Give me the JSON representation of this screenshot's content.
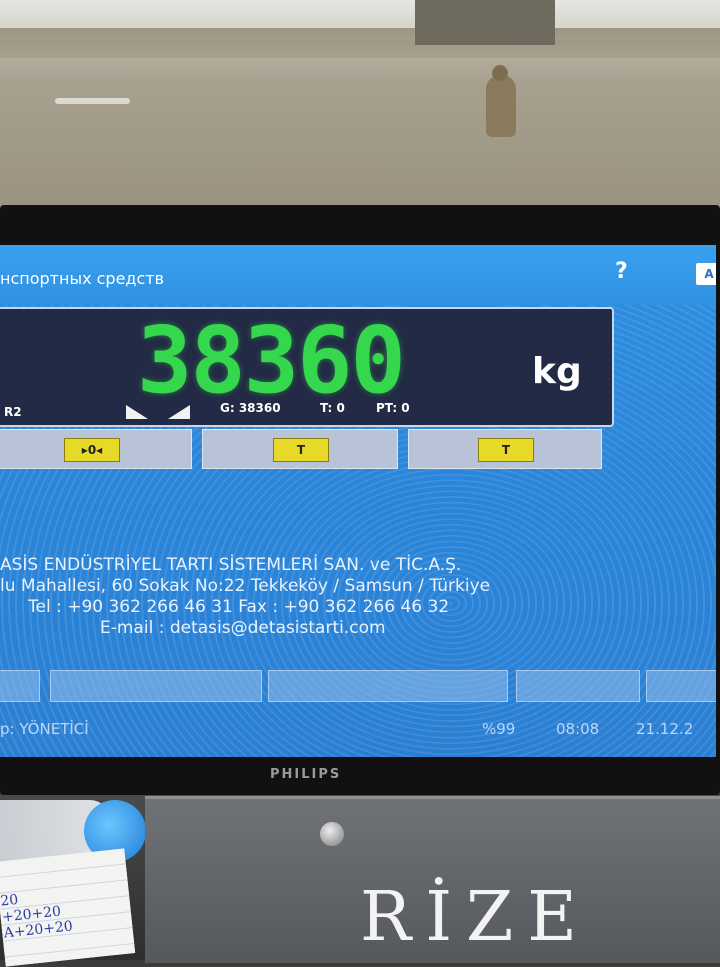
{
  "window": {
    "title": "нспортных средств",
    "help_icon": "?",
    "language_button": "A"
  },
  "scale": {
    "weight_value": "38360",
    "weight_unit": "kg",
    "indicators": {
      "left_label": "R2",
      "gross": "G: 38360",
      "tare": "T: 0",
      "preset_tare": "PT: 0"
    },
    "buttons": [
      {
        "label": "▸0◂",
        "icon": "zero-icon"
      },
      {
        "label": "T",
        "icon": "tare-icon"
      },
      {
        "label": "T",
        "icon": "tare-icon"
      }
    ]
  },
  "company": {
    "line1": "ASİS ENDÜSTRİYEL TARTI SİSTEMLERİ SAN. ve TİC.A.Ş.",
    "line2": "lu Mahallesi, 60 Sokak No:22 Tekkeköy / Samsun / Türkiye",
    "line3": "Tel : +90 362 266 46 31 Fax : +90 362 266 46 32",
    "line4": "E-mail : detasis@detasistarti.com"
  },
  "status": {
    "user": "p: YÖNETİCİ",
    "battery": "%99",
    "time": "08:08",
    "date": "21.12.2"
  },
  "monitor": {
    "brand": "PHILIPS"
  },
  "desk": {
    "note_lines": "20\n+20+20\nA+20+20",
    "box_writing": "RİZE"
  },
  "colors": {
    "screen_blue": "#2f8fe0",
    "digit_green": "#35d84c",
    "panel_dark": "#222a45",
    "key_yellow": "#e7d928"
  }
}
